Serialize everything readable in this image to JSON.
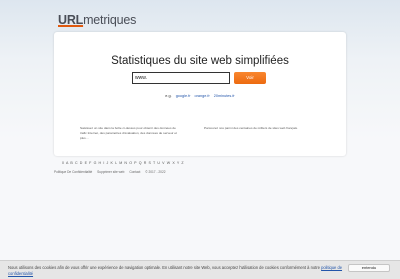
{
  "brand": {
    "part1": "URL",
    "part2": "metriques"
  },
  "main": {
    "title": "Statistiques du site web simplifiées",
    "search": {
      "value": "www.",
      "placeholder": ""
    },
    "search_button": "Voir",
    "examples_prefix": "e.g.",
    "examples": [
      "google.fr",
      "orange.fr",
      "20minutes.fr"
    ],
    "desc_left": "Saisissez un site dans la boîte ci-dessus pour obtenir des données de trafic Internet, des paramètres d'évaluation, des données de serveur et plus…",
    "desc_right": "Parcourez nos parmi des centaines de milliers de sites web français."
  },
  "alphabet": "0 A B C D E F G H I J K L M N O P Q R S T U V W X Y Z",
  "footer": {
    "links": [
      "Politique De Confidentialité",
      "Supprimer site web",
      "Contact"
    ],
    "copyright": "© 2017 - 2022"
  },
  "cookie": {
    "text": "Nous utilisons des cookies afin de vous offrir une expérience de navigation optimale. En utilisant notre site Web, vous acceptez l'utilisation de cookies conformément à notre",
    "link": "politique de confidentialité",
    "button": "entendu"
  },
  "colors": {
    "accent": "#ec6a10",
    "link": "#2255aa",
    "cookie_bar": "#e6e6e6"
  }
}
